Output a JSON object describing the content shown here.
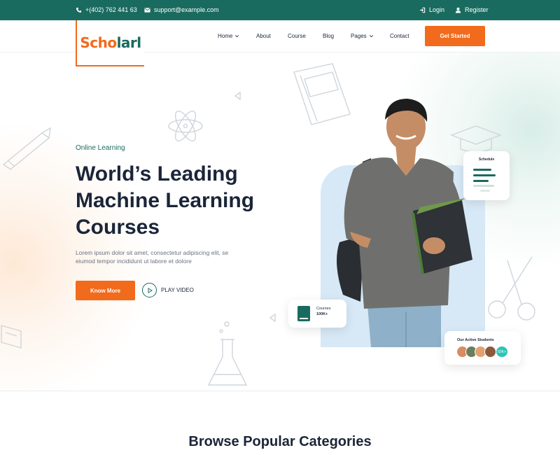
{
  "topbar": {
    "phone": "+(402) 762 441 63",
    "email": "support@example.com",
    "login": "Login",
    "register": "Register"
  },
  "brand": {
    "logo_part1": "Scho",
    "logo_part2": "larl",
    "colors": {
      "accent": "#f26a1b",
      "primary": "#1a6b5f"
    }
  },
  "nav": {
    "items": [
      {
        "label": "Home",
        "dropdown": true
      },
      {
        "label": "About",
        "dropdown": false
      },
      {
        "label": "Course",
        "dropdown": false
      },
      {
        "label": "Blog",
        "dropdown": false
      },
      {
        "label": "Pages",
        "dropdown": true
      },
      {
        "label": "Contact",
        "dropdown": false
      }
    ],
    "cta": "Get Started"
  },
  "hero": {
    "eyebrow": "Online Learning",
    "title": "World’s Leading Machine Learning Courses",
    "description": "Lorem ipsum dolor sit amet, consectetur adipiscing elit, se eiumod tempor incididunt ut labore et dolore",
    "primary_button": "Know More",
    "video_button": "PLAY VIDEO"
  },
  "cards": {
    "schedule": {
      "title": "Schedule"
    },
    "courses": {
      "label": "Courses",
      "count": "100K+"
    },
    "students": {
      "title": "Our Active Students",
      "count": "50K+"
    }
  },
  "section": {
    "title": "Browse Popular Categories"
  }
}
